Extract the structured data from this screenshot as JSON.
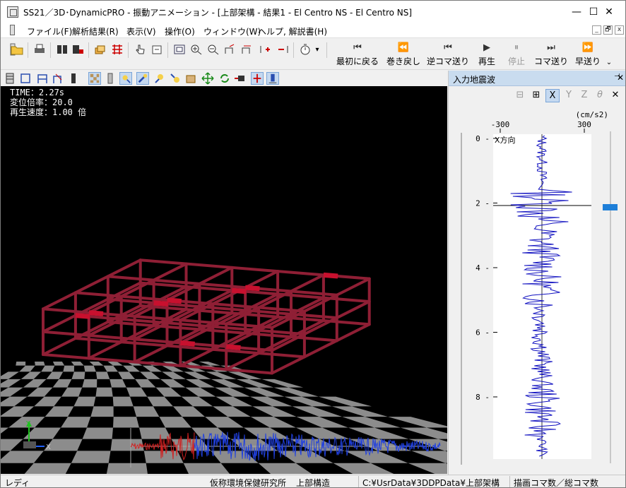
{
  "window": {
    "title": "SS21／3D･DynamicPRO - 振動アニメーション - [上部架構 - 結果1 - El Centro NS - El Centro NS]",
    "minimize": "—",
    "maximize": "☐",
    "close": "✕"
  },
  "menu": {
    "items": [
      "ファイル(F)",
      "解析結果(R)",
      "表示(V)",
      "操作(O)",
      "ウィンドウ(W)",
      "ヘルプ, 解説書(H)"
    ],
    "mdi": [
      "_",
      "🗗",
      "x"
    ]
  },
  "playback": {
    "buttons": [
      {
        "label": "最初に戻る",
        "glyph": "⏮",
        "enabled": true
      },
      {
        "label": "巻き戻し",
        "glyph": "⏪",
        "enabled": true
      },
      {
        "label": "逆コマ送り",
        "glyph": "⏮",
        "enabled": true
      },
      {
        "label": "再生",
        "glyph": "▶",
        "enabled": true
      },
      {
        "label": "停止",
        "glyph": "⏸",
        "enabled": false
      },
      {
        "label": "コマ送り",
        "glyph": "⏭",
        "enabled": true
      },
      {
        "label": "早送り",
        "glyph": "⏩",
        "enabled": true
      }
    ],
    "more": "⌄"
  },
  "viewport": {
    "time_line": "TIME：2.27s",
    "scale_line": "変位倍率：20.0",
    "speed_line": "再生速度：1.00 倍",
    "axis_y": "Y",
    "axis_x": "X"
  },
  "panel": {
    "title": "入力地震波",
    "pin": "📌",
    "close": "✕",
    "tools": [
      "⊟",
      "⊞",
      "X",
      "Y",
      "Z",
      "θ",
      "✕"
    ],
    "active_tool": "X",
    "unit": "(cm/s2)",
    "x_ticks": [
      "-300",
      "300"
    ],
    "direction": "X方向",
    "y_ticks": [
      "0",
      "2",
      "4",
      "6",
      "8"
    ]
  },
  "status": {
    "ready": "レディ",
    "org": "仮称環境保健研究所",
    "structure": "上部構造",
    "path": "C:¥UsrData¥3DDPData¥上部架構",
    "frames": "描画コマ数／総コマ数"
  },
  "colors": {
    "frame": "#8f1f35",
    "accent": "#1e7fd8",
    "wave": "#1010c0"
  }
}
